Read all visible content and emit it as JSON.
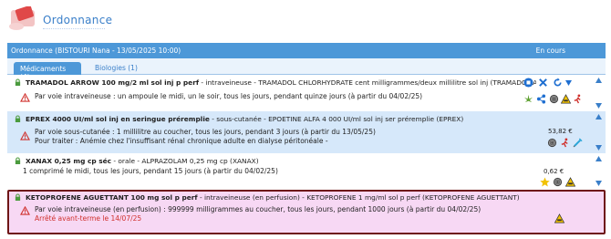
{
  "app": {
    "title": "Ordonnance"
  },
  "banner": {
    "patient": "Ordonnance (BISTOURI Nana  - 13/05/2025 10:00)",
    "status": "En cours"
  },
  "tabs": [
    {
      "label": "Médicaments (4)",
      "active": true
    },
    {
      "label": "Biologies (1)",
      "active": false
    }
  ],
  "colors": {
    "accent": "#4d98d8",
    "row_alt": "#d6e8fa",
    "selected_row": "#f7d8f4",
    "selected_border": "#6e1515",
    "warning": "#d0312d"
  },
  "meds": [
    {
      "name": "TRAMADOL ARROW 100 mg/2 ml sol inj p perf",
      "info": " - intraveineuse - TRAMADOL CHLORHYDRATE cent milligrammes/deux millilitre sol inj (TRAMADOL ARROW)",
      "lines": [
        "Par voie intraveineuse : un ampoule le midi, un le soir, tous les jours, pendant quinze jours (à partir du 04/02/25)"
      ],
      "price": "",
      "icons": [
        "stop-icon",
        "delete-icon",
        "renew-icon",
        "dropdown-icon",
        "cannabis-icon",
        "interaction-icon",
        "fingerprint-icon",
        "warning-road-icon",
        "runner-icon"
      ]
    },
    {
      "name": "EPREX 4000 UI/ml sol inj en seringue préremplie",
      "info": " - sous-cutanée - EPOETINE ALFA 4 000 UI/ml sol inj ser préremplie (EPREX)",
      "lines": [
        "Par voie sous-cutanée : 1 millilitre au coucher, tous les jours, pendant 3 jours (à partir du 13/05/25)",
        "Pour traiter : Anémie chez l'insuffisant rénal chronique adulte en dialyse péritonéale -"
      ],
      "price": "53,82 €",
      "icons": [
        "fingerprint-icon",
        "runner-icon",
        "syringe-icon"
      ]
    },
    {
      "name": "XANAX 0,25 mg cp séc",
      "info": " - orale - ALPRAZOLAM 0,25 mg cp (XANAX)",
      "lines": [
        "1 comprimé le midi, tous les jours, pendant 15 jours (à partir du 04/02/25)"
      ],
      "price": "0,62 €",
      "icons": [
        "star-icon",
        "fingerprint-icon",
        "warning-road-icon"
      ]
    },
    {
      "name": "KETOPROFENE AGUETTANT 100 mg sol p perf",
      "info": " - intraveineuse (en perfusion) - KETOPROFENE 1 mg/ml sol p perf (KETOPROFENE AGUETTANT)",
      "lines": [
        "Par voie intraveineuse (en perfusion) : 999999 milligrammes au coucher, tous les jours, pendant 1000 jours (à partir du 04/02/25)"
      ],
      "stop_note": "Arrêté avant-terme le 14/07/25",
      "price": "",
      "icons": [
        "warning-road-icon"
      ]
    }
  ]
}
